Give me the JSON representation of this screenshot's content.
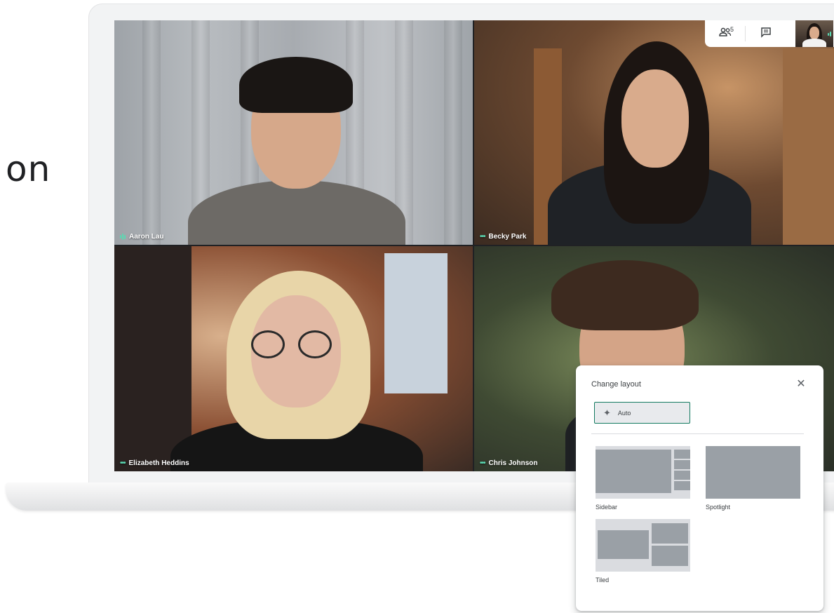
{
  "side_text": "on",
  "participants": [
    {
      "name": "Aaron Lau",
      "status_icon": "audio-level-icon"
    },
    {
      "name": "Becky Park",
      "status_icon": "muted-dots-icon"
    },
    {
      "name": "Elizabeth Heddins",
      "status_icon": "muted-dots-icon"
    },
    {
      "name": "Chris Johnson",
      "status_icon": "muted-dots-icon"
    }
  ],
  "toolbar": {
    "people_icon": "people-icon",
    "people_count": "5",
    "chat_icon": "chat-icon"
  },
  "layout_panel": {
    "title": "Change layout",
    "close_icon": "close-icon",
    "auto_label": "Auto",
    "options": [
      {
        "label": "Sidebar"
      },
      {
        "label": "Spotlight"
      },
      {
        "label": "Tiled"
      }
    ]
  },
  "colors": {
    "accent": "#137a60",
    "audio_indicator": "#5bd9b2"
  }
}
